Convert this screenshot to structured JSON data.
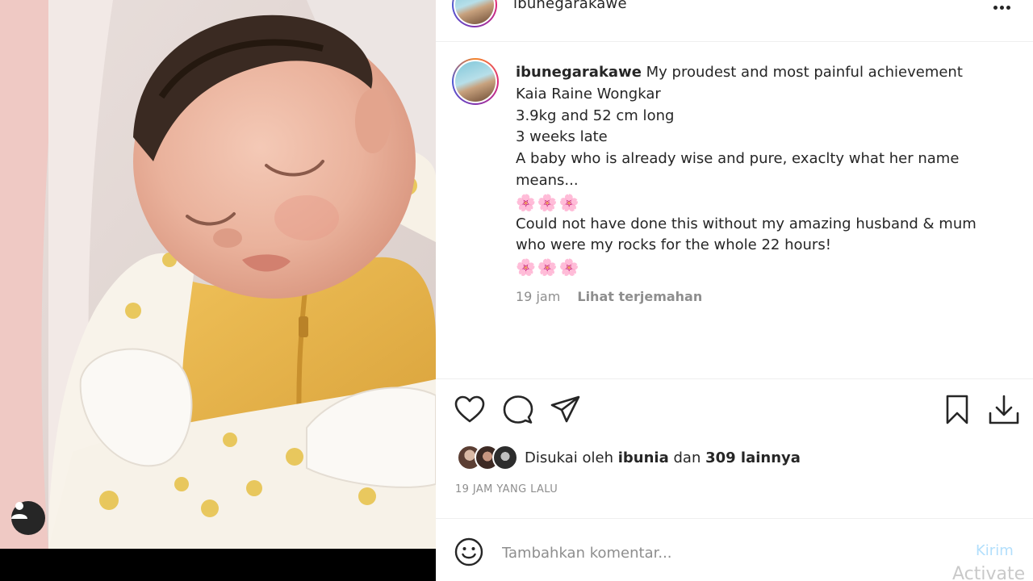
{
  "post": {
    "username": "ibunegarakawe",
    "caption": {
      "username": "ibunegarakawe",
      "lines": [
        "My proudest and most painful achievement",
        "Kaia Raine Wongkar",
        "3.9kg and 52 cm long",
        "3 weeks late",
        "A baby who is already wise and pure, exaclty what her name",
        "means..."
      ],
      "flowers_1": "🌸🌸🌸",
      "lines2": [
        "Could not have done this without my amazing husband & mum",
        "who were my rocks for the whole 22 hours!"
      ],
      "flowers_2": "🌸🌸🌸"
    },
    "caption_time": "19 jam",
    "translate_label": "Lihat terjemahan",
    "likes": {
      "prefix": "Disukai oleh",
      "liker": "ibunia",
      "connector": "dan",
      "others": "309 lainnya"
    },
    "timestamp": "19 JAM YANG LALU"
  },
  "comment": {
    "placeholder": "Tambahkan komentar...",
    "send_label": "Kirim"
  },
  "watermark": "Activate",
  "icons": {
    "more": "more-horizontal-icon",
    "like": "heart-icon",
    "comment": "comment-bubble-icon",
    "share": "paper-plane-icon",
    "save": "bookmark-icon",
    "download": "download-icon",
    "emoji": "smiley-icon",
    "user_tag": "user-icon"
  },
  "colors": {
    "send_disabled": "#b2dffc",
    "muted_text": "#8e8e8e",
    "onesie": "#e8b44a"
  }
}
